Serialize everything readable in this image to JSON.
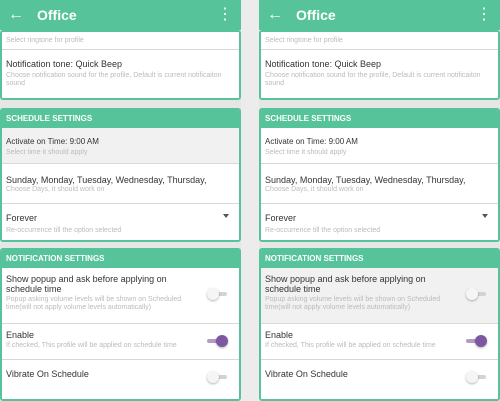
{
  "colors": {
    "accent": "#56c39a",
    "toggle_on": "#7d57a0",
    "toggle_off": "#f5f5f5"
  },
  "appbar": {
    "title": "Office",
    "back_icon": "arrow-back-icon",
    "more_icon": "more-vert-icon"
  },
  "top_card": {
    "ringtone_hint": "Select ringtone for profile",
    "notification_tone_title": "Notification tone: Quick Beep",
    "notification_tone_hint": "Choose notification sound for the profile, Default is current notificaiton sound"
  },
  "schedule": {
    "header": "SCHEDULE SETTINGS",
    "activate_title": "Activate on Time: 9:00 AM",
    "activate_hint": "Select time it should apply",
    "days_title": "Sunday, Monday, Tuesday, Wednesday, Thursday,",
    "days_hint": "Choose Days, it should work on",
    "recurrence_value": "Forever",
    "recurrence_hint": "Re-occurrence till the option selected"
  },
  "notification": {
    "header": "NOTIFICATION SETTINGS",
    "popup_title": "Show popup and ask before applying on schedule time",
    "popup_hint": "Popup asking volume levels will be shown on Scheduled time(will not apply volume levels automatically)",
    "popup_enabled": false,
    "enable_title": "Enable",
    "enable_hint": "If checked, This profile will be applied on schedule time",
    "enable_enabled": true,
    "vibrate_title": "Vibrate On Schedule",
    "vibrate_enabled": false
  }
}
